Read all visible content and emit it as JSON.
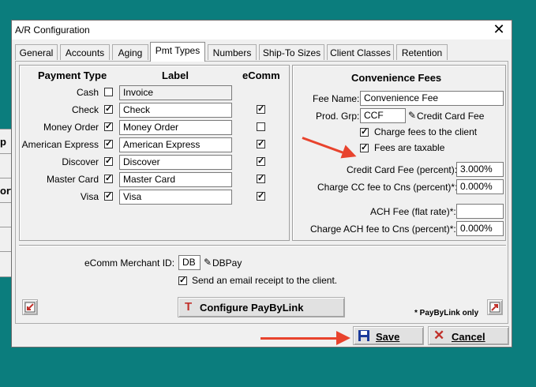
{
  "background_buttons": [
    "p",
    "",
    "ort",
    "",
    "",
    ""
  ],
  "window": {
    "title": "A/R Configuration",
    "close_glyph": "✕"
  },
  "tabs": [
    "General",
    "Accounts",
    "Aging",
    "Pmt Types",
    "Numbers",
    "Ship-To Sizes",
    "Client Classes",
    "Retention"
  ],
  "active_tab": "Pmt Types",
  "payment_types": {
    "headers": {
      "type": "Payment Type",
      "label": "Label",
      "ecomm": "eComm"
    },
    "rows": [
      {
        "type": "Cash",
        "enabled": false,
        "label": "Invoice",
        "readonly": true,
        "ecomm": null
      },
      {
        "type": "Check",
        "enabled": true,
        "label": "Check",
        "readonly": false,
        "ecomm": true
      },
      {
        "type": "Money Order",
        "enabled": true,
        "label": "Money Order",
        "readonly": false,
        "ecomm": false
      },
      {
        "type": "American Express",
        "enabled": true,
        "label": "American Express",
        "readonly": false,
        "ecomm": true
      },
      {
        "type": "Discover",
        "enabled": true,
        "label": "Discover",
        "readonly": false,
        "ecomm": true
      },
      {
        "type": "Master Card",
        "enabled": true,
        "label": "Master Card",
        "readonly": false,
        "ecomm": true
      },
      {
        "type": "Visa",
        "enabled": true,
        "label": "Visa",
        "readonly": false,
        "ecomm": true
      }
    ]
  },
  "convenience_fees": {
    "title": "Convenience Fees",
    "fee_name_label": "Fee Name:",
    "fee_name_value": "Convenience Fee",
    "prod_grp_label": "Prod. Grp:",
    "prod_grp_value": "CCF",
    "prod_grp_desc": "Credit Card Fee",
    "charge_fees_label": "Charge fees to the client",
    "charge_fees_checked": true,
    "taxable_label": "Fees are taxable",
    "taxable_checked": true,
    "cc_fee_label": "Credit Card Fee (percent):",
    "cc_fee_value": "3.000%",
    "charge_cc_label": "Charge CC fee to Cns (percent)*:",
    "charge_cc_value": "0.000%",
    "ach_fee_label": "ACH Fee (flat rate)*:",
    "ach_fee_value": "",
    "charge_ach_label": "Charge ACH fee to Cns (percent)*:",
    "charge_ach_value": "0.000%"
  },
  "ecomm": {
    "merchant_label": "eComm Merchant ID:",
    "merchant_value": "DB",
    "merchant_desc": "DBPay",
    "email_receipt_label": "Send an email receipt to the client.",
    "email_receipt_checked": true,
    "configure_label": "Configure PayByLink",
    "paybylink_note": "* PayByLink only"
  },
  "footer": {
    "save_label": "Save",
    "cancel_label": "Cancel"
  },
  "colors": {
    "desktop": "#0b7d7d",
    "annotation_arrow": "#e8432d"
  }
}
